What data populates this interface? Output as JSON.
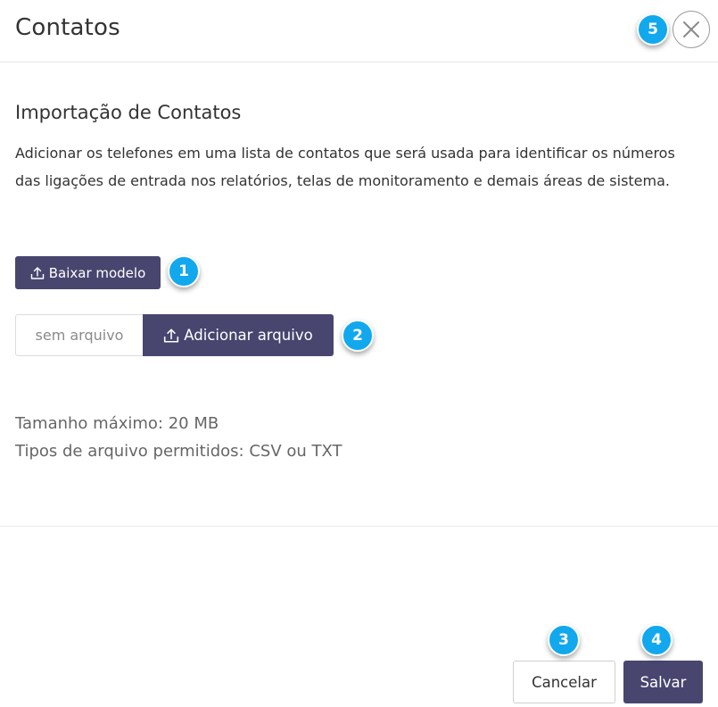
{
  "header": {
    "title": "Contatos"
  },
  "section": {
    "title": "Importação de Contatos",
    "description": "Adicionar os telefones em uma lista de contatos que será usada para identificar os números das ligações de entrada nos relatórios, telas de monitoramento e demais áreas de sistema."
  },
  "actions": {
    "download_label": "Baixar modelo",
    "file_placeholder": "sem arquivo",
    "add_file_label": "Adicionar arquivo"
  },
  "info": {
    "max_size": "Tamanho máximo: 20 MB",
    "allowed_types": "Tipos de arquivo permitidos: CSV ou TXT"
  },
  "footer": {
    "cancel_label": "Cancelar",
    "save_label": "Salvar"
  },
  "badges": {
    "b1": "1",
    "b2": "2",
    "b3": "3",
    "b4": "4",
    "b5": "5"
  },
  "icons": {
    "close": "close-icon",
    "upload": "upload-icon"
  },
  "colors": {
    "primary": "#48466f",
    "badge": "#12a8ee"
  }
}
